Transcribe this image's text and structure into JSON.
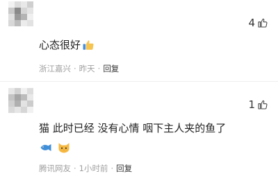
{
  "comments": [
    {
      "text": "心态很好",
      "likes": "4",
      "location": "浙江嘉兴",
      "time": "昨天",
      "reply": "回复",
      "separator": "·"
    },
    {
      "text": "猫 此时已经 没有心情 咽下主人夹的鱼了",
      "likes": "1",
      "location": "腾讯网友",
      "time": "1小时前",
      "reply": "回复",
      "separator": "·"
    }
  ],
  "icons": {
    "like": "thumb-up-outline-icon",
    "inline_emoji": "thumbs-up-emoji-icon",
    "fish": "fish-emoji-icon",
    "cat": "cat-face-emoji-icon"
  },
  "colors": {
    "meta_text": "#a0a0a0",
    "body_text": "#222222",
    "reply_text": "#333333"
  }
}
